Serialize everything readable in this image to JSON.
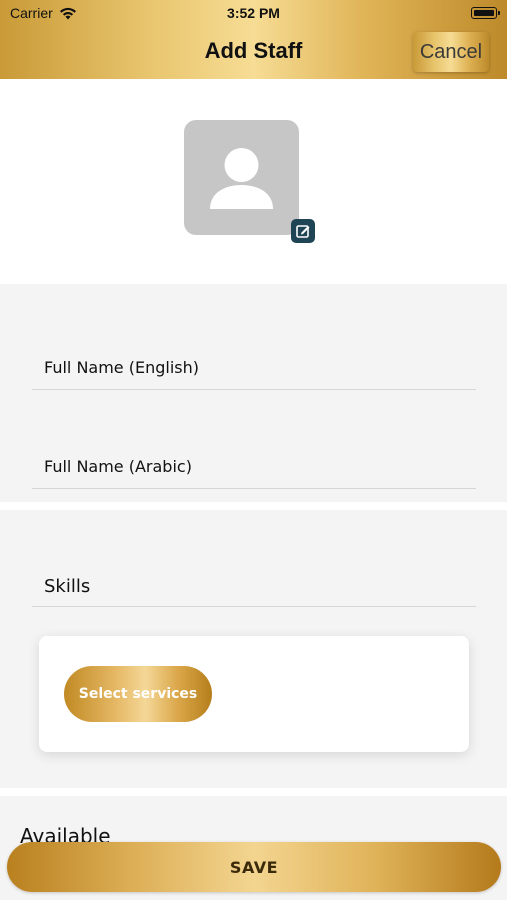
{
  "status_bar": {
    "carrier": "Carrier",
    "time": "3:52 PM",
    "icons": [
      "wifi-icon",
      "battery-icon"
    ]
  },
  "header": {
    "title": "Add Staff",
    "cancel_label": "Cancel"
  },
  "avatar": {
    "icon": "person-placeholder-icon",
    "edit_icon": "edit-icon"
  },
  "form": {
    "full_name_english_label": "Full Name (English)",
    "full_name_arabic_label": "Full Name (Arabic)",
    "skills_label": "Skills",
    "select_services_label": "Select services",
    "available_label": "Available"
  },
  "footer": {
    "save_label": "SAVE"
  },
  "colors": {
    "gold_light": "#f6dc94",
    "gold_dark": "#bd8a2a",
    "edit_icon_bg": "#1f4454",
    "avatar_bg": "#c6c6c6"
  }
}
